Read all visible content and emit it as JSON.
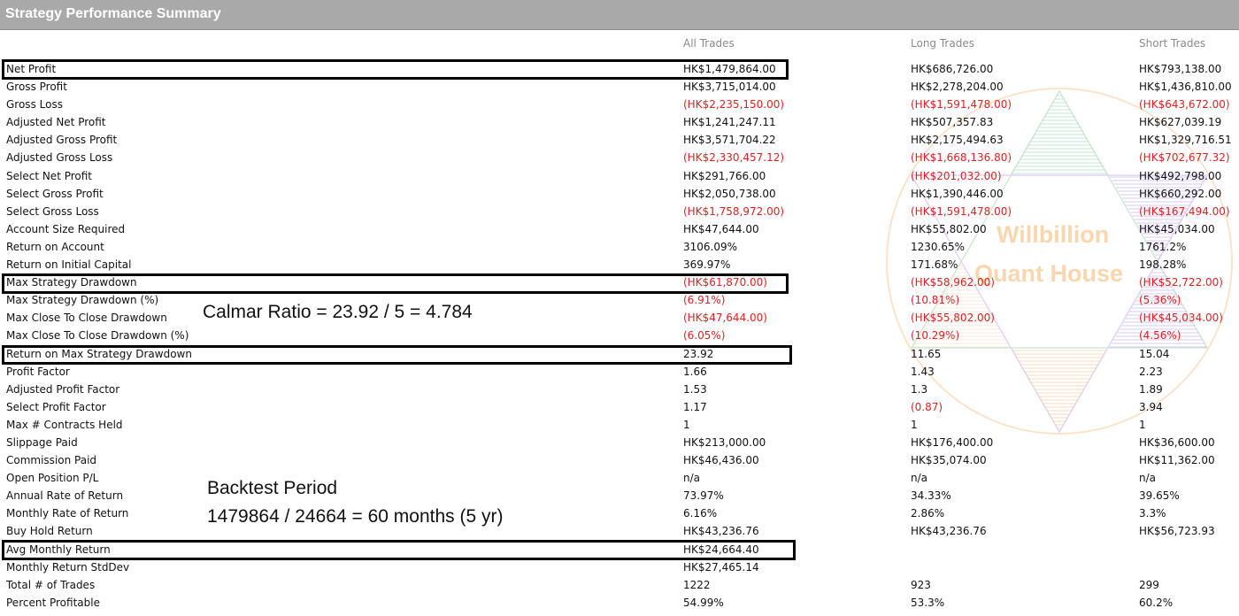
{
  "title": "Strategy Performance Summary",
  "columns": [
    "All Trades",
    "Long Trades",
    "Short Trades"
  ],
  "rows": [
    {
      "label": "Net Profit",
      "all": "HK$1,479,864.00",
      "long": "HK$686,726.00",
      "short": "HK$793,138.00"
    },
    {
      "label": "Gross Profit",
      "all": "HK$3,715,014.00",
      "long": "HK$2,278,204.00",
      "short": "HK$1,436,810.00"
    },
    {
      "label": "Gross Loss",
      "all": "(HK$2,235,150.00)",
      "long": "(HK$1,591,478.00)",
      "short": "(HK$643,672.00)"
    },
    {
      "label": "Adjusted Net Profit",
      "all": "HK$1,241,247.11",
      "long": "HK$507,357.83",
      "short": "HK$627,039.19"
    },
    {
      "label": "Adjusted Gross Profit",
      "all": "HK$3,571,704.22",
      "long": "HK$2,175,494.63",
      "short": "HK$1,329,716.51"
    },
    {
      "label": "Adjusted Gross Loss",
      "all": "(HK$2,330,457.12)",
      "long": "(HK$1,668,136.80)",
      "short": "(HK$702,677.32)"
    },
    {
      "label": "Select Net Profit",
      "all": "HK$291,766.00",
      "long": "(HK$201,032.00)",
      "short": "HK$492,798.00"
    },
    {
      "label": "Select Gross Profit",
      "all": "HK$2,050,738.00",
      "long": "HK$1,390,446.00",
      "short": "HK$660,292.00"
    },
    {
      "label": "Select Gross Loss",
      "all": "(HK$1,758,972.00)",
      "long": "(HK$1,591,478.00)",
      "short": "(HK$167,494.00)"
    },
    {
      "label": "Account Size Required",
      "all": "HK$47,644.00",
      "long": "HK$55,802.00",
      "short": "HK$45,034.00"
    },
    {
      "label": "Return on Account",
      "all": "3106.09%",
      "long": "1230.65%",
      "short": "1761.2%"
    },
    {
      "label": "Return on Initial Capital",
      "all": "369.97%",
      "long": "171.68%",
      "short": "198.28%"
    },
    {
      "label": "Max Strategy Drawdown",
      "all": "(HK$61,870.00)",
      "long": "(HK$58,962.00)",
      "short": "(HK$52,722.00)"
    },
    {
      "label": "Max Strategy Drawdown (%)",
      "all": "(6.91%)",
      "long": "(10.81%)",
      "short": "(5.36%)"
    },
    {
      "label": "Max Close To Close Drawdown",
      "all": "(HK$47,644.00)",
      "long": "(HK$55,802.00)",
      "short": "(HK$45,034.00)"
    },
    {
      "label": "Max Close To Close Drawdown (%)",
      "all": "(6.05%)",
      "long": "(10.29%)",
      "short": "(4.56%)"
    },
    {
      "label": "Return on Max Strategy Drawdown",
      "all": "23.92",
      "long": "11.65",
      "short": "15.04"
    },
    {
      "label": "Profit Factor",
      "all": "1.66",
      "long": "1.43",
      "short": "2.23"
    },
    {
      "label": "Adjusted Profit Factor",
      "all": "1.53",
      "long": "1.3",
      "short": "1.89"
    },
    {
      "label": "Select Profit Factor",
      "all": "1.17",
      "long": "(0.87)",
      "short": "3.94"
    },
    {
      "label": "Max # Contracts Held",
      "all": "1",
      "long": "1",
      "short": "1"
    },
    {
      "label": "Slippage Paid",
      "all": "HK$213,000.00",
      "long": "HK$176,400.00",
      "short": "HK$36,600.00"
    },
    {
      "label": "Commission Paid",
      "all": "HK$46,436.00",
      "long": "HK$35,074.00",
      "short": "HK$11,362.00"
    },
    {
      "label": "Open Position P/L",
      "all": "n/a",
      "long": "n/a",
      "short": "n/a"
    },
    {
      "label": "Annual Rate of Return",
      "all": "73.97%",
      "long": "34.33%",
      "short": "39.65%"
    },
    {
      "label": "Monthly Rate of Return",
      "all": "6.16%",
      "long": "2.86%",
      "short": "3.3%"
    },
    {
      "label": "Buy  Hold Return",
      "all": "HK$43,236.76",
      "long": "HK$43,236.76",
      "short": "HK$56,723.93"
    },
    {
      "label": "Avg Monthly Return",
      "all": "HK$24,664.40",
      "long": "",
      "short": ""
    },
    {
      "label": "Monthly Return StdDev",
      "all": "HK$27,465.14",
      "long": "",
      "short": ""
    },
    {
      "label": "Total # of Trades",
      "all": "1222",
      "long": "923",
      "short": "299"
    },
    {
      "label": "Percent Profitable",
      "all": "54.99%",
      "long": "53.3%",
      "short": "60.2%"
    }
  ],
  "highlighted_rows": [
    "Net Profit",
    "Max Strategy Drawdown",
    "Return on Max Strategy Drawdown",
    "Avg Monthly Return"
  ],
  "annotations": {
    "calmar": "Calmar Ratio = 23.92 / 5 = 4.784",
    "backtest_title": "Backtest Period",
    "backtest_calc": "1479864 / 24664 = 60 months (5 yr)"
  },
  "watermark": {
    "line1": "Willbillion",
    "line2": "Quant House"
  },
  "colors": {
    "negative": "#e02020",
    "header_bar": "#a9a9a9",
    "watermark": "#f8cfa0"
  }
}
